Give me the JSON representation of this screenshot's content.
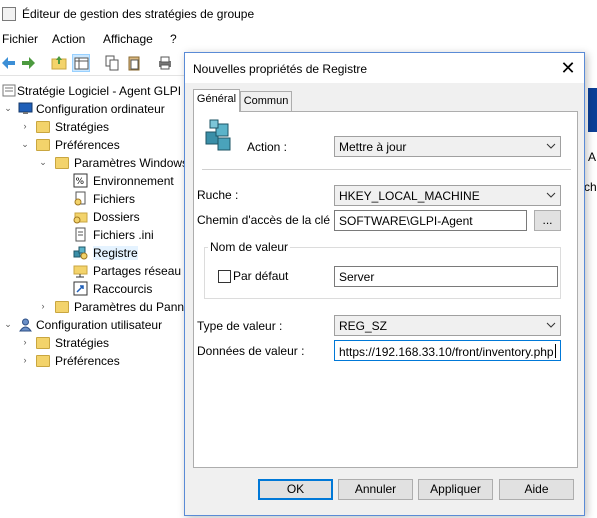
{
  "window": {
    "title": "Éditeur de gestion des stratégies de groupe"
  },
  "menu": {
    "items": [
      "Fichier",
      "Action",
      "Affichage",
      "?"
    ]
  },
  "tree": {
    "items": [
      {
        "label": "Stratégie Logiciel - Agent GLPI - ",
        "level": 0
      },
      {
        "label": "Configuration ordinateur",
        "level": 0
      },
      {
        "label": "Stratégies",
        "level": 1
      },
      {
        "label": "Préférences",
        "level": 1
      },
      {
        "label": "Paramètres Windows",
        "level": 2
      },
      {
        "label": "Environnement",
        "level": 3
      },
      {
        "label": "Fichiers",
        "level": 3
      },
      {
        "label": "Dossiers",
        "level": 3
      },
      {
        "label": "Fichiers .ini",
        "level": 3
      },
      {
        "label": "Registre",
        "level": 3
      },
      {
        "label": "Partages réseau",
        "level": 3
      },
      {
        "label": "Raccourcis",
        "level": 3
      },
      {
        "label": "Paramètres du Panne",
        "level": 2
      },
      {
        "label": "Configuration utilisateur",
        "level": 0
      },
      {
        "label": "Stratégies",
        "level": 1
      },
      {
        "label": "Préférences",
        "level": 1
      }
    ]
  },
  "right_pane": {
    "text1": "A",
    "text2": "che"
  },
  "dialog": {
    "title": "Nouvelles propriétés de Registre",
    "tabs": [
      "Général",
      "Commun"
    ],
    "action_label": "Action :",
    "action_value": "Mettre à jour",
    "ruche_label": "Ruche :",
    "ruche_value": "HKEY_LOCAL_MACHINE",
    "chemin_label": "Chemin d'accès de la clé :",
    "chemin_value": "SOFTWARE\\GLPI-Agent",
    "browse_label": "...",
    "nom_group_label": "Nom de valeur",
    "par_defaut_label": "Par défaut",
    "nom_value": "Server",
    "type_label": "Type de valeur :",
    "type_value": "REG_SZ",
    "donnees_label": "Données de valeur :",
    "donnees_value": "https://192.168.33.10/front/inventory.php",
    "buttons": {
      "ok": "OK",
      "annuler": "Annuler",
      "appliquer": "Appliquer",
      "aide": "Aide"
    }
  },
  "colors": {
    "accent": "#0078d7",
    "dialog_bg": "#f0f0f0",
    "folder": "#f3d36b"
  }
}
